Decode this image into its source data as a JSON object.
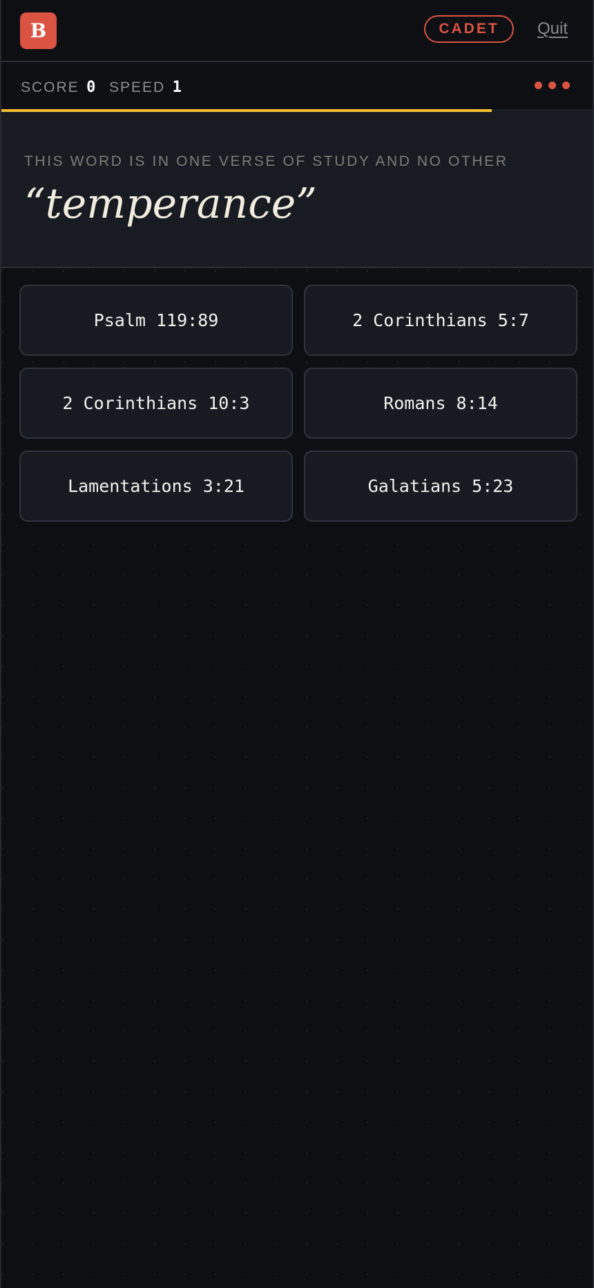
{
  "header": {
    "logo_letter": "B",
    "rank": "CADET",
    "quit_label": "Quit"
  },
  "stats": {
    "score_label": "SCORE",
    "score": "0",
    "speed_label": "SPEED",
    "speed": "1",
    "lives_remaining": 3
  },
  "timer": {
    "remaining_fraction": 0.83,
    "color": "#f2c131"
  },
  "prompt": {
    "instruction": "THIS WORD IS IN ONE VERSE OF STUDY AND NO OTHER",
    "word": "“temperance”"
  },
  "answers": [
    "Psalm 119:89",
    "2 Corinthians 5:7",
    "2 Corinthians 10:3",
    "Romans 8:14",
    "Lamentations 3:21",
    "Galatians 5:23"
  ],
  "colors": {
    "accent": "#db5443",
    "background": "#0d0f13",
    "panel": "#181b22"
  }
}
